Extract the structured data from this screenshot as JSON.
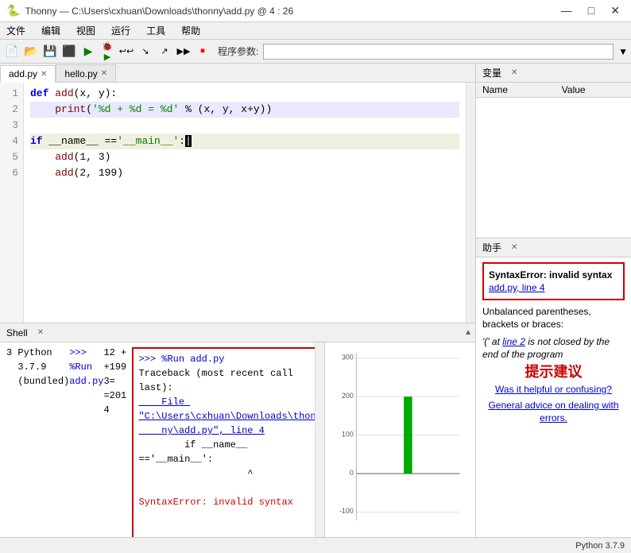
{
  "titlebar": {
    "title": "Thonny — C:\\Users\\cxhuan\\Downloads\\thonny\\add.py @ 4 : 26",
    "icon": "🐍",
    "controls": {
      "minimize": "—",
      "maximize": "□",
      "close": "✕"
    }
  },
  "menubar": {
    "items": [
      "文件",
      "编辑",
      "视图",
      "运行",
      "工具",
      "帮助"
    ]
  },
  "toolbar": {
    "buttons": [
      "📂",
      "💾",
      "✕",
      "▶",
      "🐞",
      "↩",
      "↪",
      "⏭",
      "⏩",
      "⏺",
      "⏹"
    ],
    "program_args_label": "程序参数:",
    "program_args_value": ""
  },
  "editor": {
    "tabs": [
      {
        "label": "add.py",
        "active": true
      },
      {
        "label": "hello.py",
        "active": false
      }
    ],
    "lines": [
      {
        "num": 1,
        "text": "def add(x, y):",
        "tokens": [
          {
            "type": "kw",
            "val": "def"
          },
          {
            "type": "sp",
            "val": " "
          },
          {
            "type": "fn",
            "val": "add"
          },
          {
            "type": "punc",
            "val": "(x, y):"
          }
        ]
      },
      {
        "num": 2,
        "text": "    print('%d + %d = %d' % (x, y, x+y))",
        "highlighted": true
      },
      {
        "num": 3,
        "text": ""
      },
      {
        "num": 4,
        "text": "if __name__ =='__main__':",
        "cursor": true
      },
      {
        "num": 5,
        "text": "    add(1, 3)"
      },
      {
        "num": 6,
        "text": "    add(2, 199)"
      }
    ]
  },
  "shell": {
    "label": "Shell",
    "output": [
      {
        "type": "normal",
        "text": "3"
      },
      {
        "type": "blank"
      },
      {
        "type": "normal",
        "text": "Python 3.7.9 (bundled)"
      },
      {
        "type": "prompt",
        "text": ">>> %Run add.py"
      },
      {
        "type": "normal",
        "text": "1 + 3 = 4"
      },
      {
        "type": "normal",
        "text": "2 + 199 = 201"
      },
      {
        "type": "blank"
      },
      {
        "type": "error_box_start"
      },
      {
        "type": "prompt",
        "text": ">>> %Run add.py"
      },
      {
        "type": "normal",
        "text": "Traceback (most recent call last):"
      },
      {
        "type": "link",
        "text": "    File \"C:\\Users\\cxhuan\\Downloads\\thon\n    ny\\add.py\", line 4"
      },
      {
        "type": "normal",
        "text": "        if __name__ =='__main__':"
      },
      {
        "type": "normal",
        "text": "                   ^"
      },
      {
        "type": "blank"
      },
      {
        "type": "error",
        "text": "SyntaxError: invalid syntax"
      },
      {
        "type": "error_box_end"
      }
    ],
    "prompt_bottom": ">>>"
  },
  "variables": {
    "label": "变量",
    "headers": [
      "Name",
      "Value"
    ],
    "rows": []
  },
  "helper": {
    "label": "助手",
    "error_title": "SyntaxError: invalid syntax",
    "error_link": "add.py, line 4",
    "body1": "Unbalanced parentheses, brackets or braces:",
    "body2": "'(' at line 2 is not closed by the end of the program",
    "suggest_label": "提示建议",
    "link1": "Was it helpful or confusing?",
    "link2": "General advice on dealing with errors."
  },
  "statusbar": {
    "python_version": "Python 3.7.9"
  },
  "chart": {
    "y_labels": [
      "300",
      "200",
      "100",
      "0",
      "-100"
    ],
    "dots": [
      "blue",
      "yellow",
      "red",
      "green"
    ]
  }
}
